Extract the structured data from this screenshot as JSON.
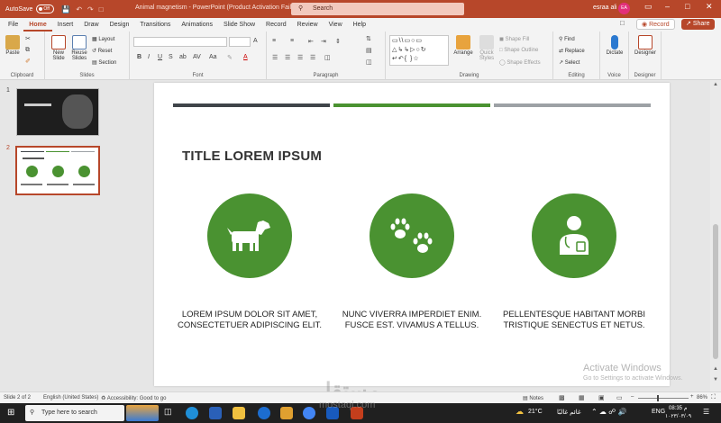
{
  "titlebar": {
    "autosave_label": "AutoSave",
    "autosave_state": "Off",
    "document_title": "Animal magnetism  -  PowerPoint (Product Activation Failed)",
    "search_placeholder": "Search",
    "user_name": "esraa ali",
    "user_initials": "EA"
  },
  "ribbon_tabs": [
    "File",
    "Home",
    "Insert",
    "Draw",
    "Design",
    "Transitions",
    "Animations",
    "Slide Show",
    "Record",
    "Review",
    "View",
    "Help"
  ],
  "ribbon_active_tab": "Home",
  "record_button": "Record",
  "share_button": "Share",
  "groups": {
    "clipboard": {
      "label": "Clipboard",
      "paste": "Paste"
    },
    "slides": {
      "label": "Slides",
      "new_slide": "New Slide",
      "reuse_slides": "Reuse Slides",
      "layout": "Layout",
      "reset": "Reset",
      "section": "Section"
    },
    "font": {
      "label": "Font"
    },
    "paragraph": {
      "label": "Paragraph"
    },
    "drawing": {
      "label": "Drawing",
      "arrange": "Arrange",
      "quick_styles": "Quick Styles",
      "shape_fill": "Shape Fill",
      "shape_outline": "Shape Outline",
      "shape_effects": "Shape Effects"
    },
    "editing": {
      "label": "Editing",
      "find": "Find",
      "replace": "Replace",
      "select": "Select"
    },
    "voice": {
      "label": "Voice",
      "dictate": "Dictate"
    },
    "designer": {
      "label": "Designer",
      "designer": "Designer"
    }
  },
  "thumbnails": [
    {
      "number": "1",
      "selected": false
    },
    {
      "number": "2",
      "selected": true
    }
  ],
  "slide": {
    "title": "TITLE LOREM IPSUM",
    "bars": [
      {
        "color": "#3f4449"
      },
      {
        "color": "#4a9231"
      },
      {
        "color": "#9da1a5"
      }
    ],
    "circle_color": "#4a9231",
    "items": [
      {
        "icon": "dog-icon",
        "line1": "LOREM IPSUM DOLOR SIT AMET,",
        "line2": "CONSECTETUER ADIPISCING ELIT."
      },
      {
        "icon": "paw-prints-icon",
        "line1": "NUNC VIVERRA IMPERDIET ENIM.",
        "line2": "FUSCE EST. VIVAMUS A TELLUS."
      },
      {
        "icon": "veterinarian-icon",
        "line1": "PELLENTESQUE HABITANT MORBI",
        "line2": "TRISTIQUE SENECTUS ET NETUS."
      }
    ]
  },
  "activation": {
    "title": "Activate Windows",
    "subtitle": "Go to Settings to activate Windows."
  },
  "statusbar": {
    "slide_count": "Slide 2 of 2",
    "language": "English (United States)",
    "accessibility": "Accessibility: Good to go",
    "notes": "Notes",
    "zoom": "86%"
  },
  "taskbar": {
    "search_placeholder": "Type here to search",
    "weather": "21°C",
    "weather_text": "غائم غالبًا",
    "language": "ENG",
    "time": "08:35 م",
    "date": "١٠٢٣/٠٣/٠٩"
  },
  "watermark_text": "مستقل",
  "watermark_url": "mostaql.com"
}
